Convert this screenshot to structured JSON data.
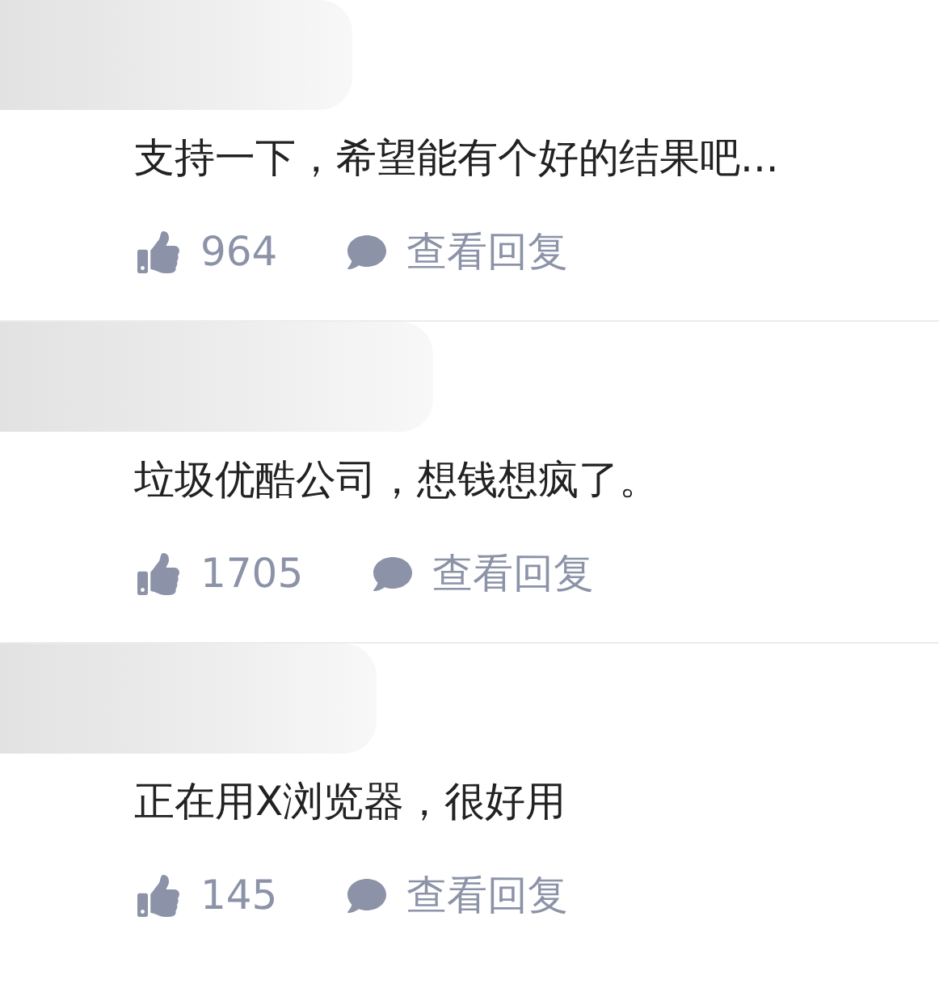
{
  "comments": [
    {
      "text": "支持一下，希望能有个好的结果吧...",
      "likes": "964",
      "reply_link": "查看回复"
    },
    {
      "text": "垃圾优酷公司，想钱想疯了。",
      "likes": "1705",
      "reply_link": "查看回复"
    },
    {
      "text": "正在用X浏览器，很好用",
      "likes": "145",
      "reply_link": "查看回复"
    }
  ]
}
